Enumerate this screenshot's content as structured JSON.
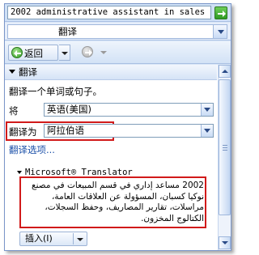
{
  "search": {
    "value": "2002 administrative assistant in sales"
  },
  "service": {
    "selected": "翻译"
  },
  "toolbar": {
    "back_label": "返回"
  },
  "section": {
    "title": "翻译"
  },
  "translate": {
    "instruction": "翻译一个单词或句子。",
    "from_label": "将",
    "from_value": "英语(美国)",
    "to_label": "翻译为",
    "to_value": "阿拉伯语",
    "options_link": "翻译选项..."
  },
  "result": {
    "provider": "Microsoft® Translator",
    "text": "2002 مساعد إداري في قسم المبيعات في مصنع نوكيا كسبان، المسؤولة عن العلاقات العامة، مراسلات، تقارير المصاريف، وحفظ السجلات، الكتالوج المخزون.",
    "insert_label": "插入(I)"
  },
  "colors": {
    "highlight_border": "#d11a1a",
    "link": "#1a4fa8",
    "accent_green": "#2f9a22"
  }
}
